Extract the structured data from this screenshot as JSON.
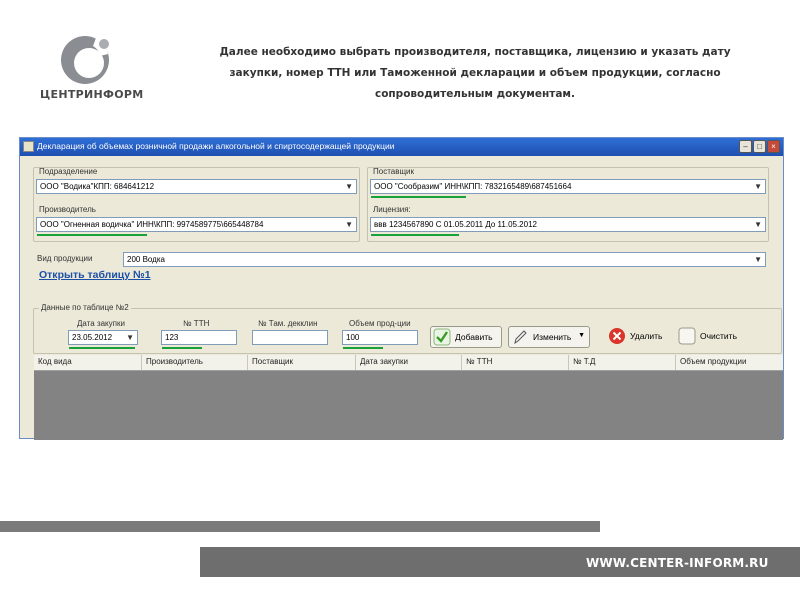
{
  "logo": {
    "text": "ЦЕНТРИНФОРМ"
  },
  "intro": {
    "line1": "Далее необходимо выбрать производителя, поставщика, лицензию и указать дату",
    "line2": "закупки, номер ТТН или Таможенной декларации и объем продукции, согласно",
    "line3": "сопроводительным документам."
  },
  "window": {
    "title": "Декларация об объемах розничной продажи алкогольной и спиртосодержащей продукции"
  },
  "form": {
    "division": {
      "label": "Подразделение",
      "value": "ООО \"Водика\"КПП: 684641212"
    },
    "supplier": {
      "label": "Поставщик",
      "value": "ООО \"Сообразим\" ИНН\\КПП: 7832165489\\687451664"
    },
    "producer": {
      "label": "Производитель",
      "value": "ООО \"Огненная водичка\"   ИНН\\КПП: 9974589775\\665448784"
    },
    "license": {
      "label": "Лицензия:",
      "value": "ввв 1234567890 С 01.05.2011 До 11.05.2012"
    },
    "product_type": {
      "label": "Вид продукции",
      "value": "200 Водка"
    },
    "open_table_link": "Открыть таблицу №1",
    "table2_group": "Данные по таблице №2",
    "purchase_date": {
      "label": "Дата закупки",
      "value": "23.05.2012"
    },
    "ttn": {
      "label": "№ ТТН",
      "value": "123"
    },
    "customs": {
      "label": "№ Там. декклин",
      "value": ""
    },
    "volume": {
      "label": "Объем прод-ции",
      "value": "100"
    }
  },
  "buttons": {
    "add": "Добавить",
    "edit": "Изменить",
    "delete": "Удалить",
    "clear": "Очистить"
  },
  "grid": {
    "columns": [
      "Код вида",
      "Производитель",
      "Поставщик",
      "Дата закупки",
      "№ ТТН",
      "№ Т.Д",
      "Объем продукции"
    ]
  },
  "footer": {
    "url": "WWW.CENTER-INFORM.RU"
  },
  "colors": {
    "accent_green": "#19a23a",
    "titlebar_blue": "#1e4fb0",
    "link_blue": "#1b4fa8"
  }
}
